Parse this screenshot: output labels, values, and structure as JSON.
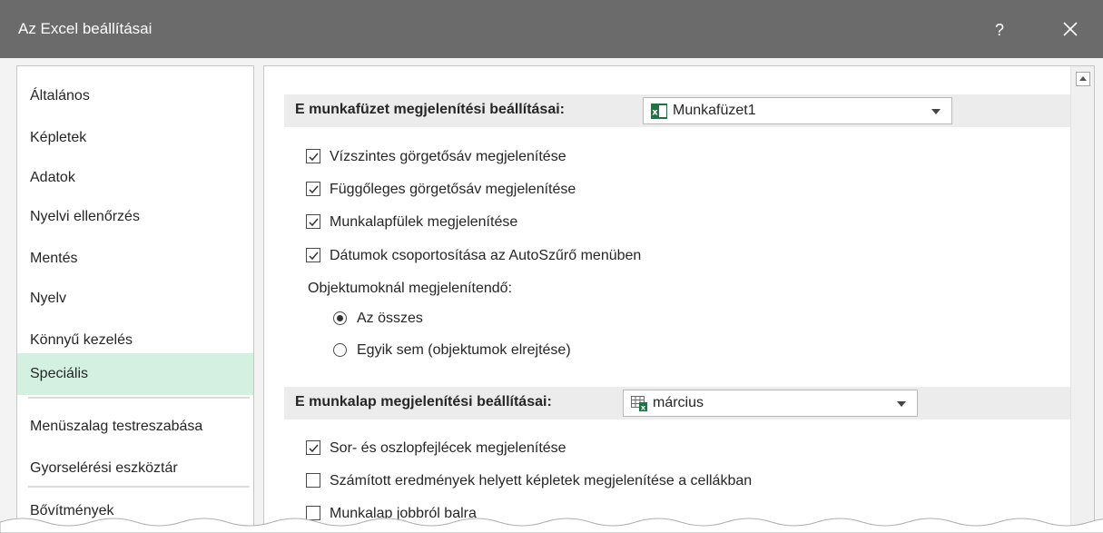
{
  "window": {
    "title": "Az Excel beállításai",
    "help_label": "?"
  },
  "sidebar": {
    "items": [
      {
        "label": "Általános"
      },
      {
        "label": "Képletek"
      },
      {
        "label": "Adatok"
      },
      {
        "label": "Nyelvi ellenőrzés"
      },
      {
        "label": "Mentés"
      },
      {
        "label": "Nyelv"
      },
      {
        "label": "Könnyű kezelés"
      },
      {
        "label": "Speciális"
      },
      {
        "label": "Menüszalag testreszabása"
      },
      {
        "label": "Gyorselérési eszköztár"
      },
      {
        "label": "Bővítmények"
      }
    ],
    "selected_index": 7
  },
  "workbook_section": {
    "label": "E munkafüzet megjelenítési beállításai:",
    "combo_value": "Munkafüzet1",
    "options": [
      {
        "label": "Vízszintes görgetősáv megjelenítése",
        "checked": true
      },
      {
        "label": "Függőleges görgetősáv megjelenítése",
        "checked": true
      },
      {
        "label": "Munkalapfülek megjelenítése",
        "checked": true
      },
      {
        "label": "Dátumok csoportosítása az AutoSzűrő menüben",
        "checked": true
      }
    ],
    "objects_label": "Objektumoknál megjelenítendő:",
    "radios": [
      {
        "label": "Az összes",
        "selected": true
      },
      {
        "label": "Egyik sem (objektumok elrejtése)",
        "selected": false
      }
    ]
  },
  "sheet_section": {
    "label": "E munkalap megjelenítési beállításai:",
    "combo_value": "március",
    "options": [
      {
        "label": "Sor- és oszlopfejlécek megjelenítése",
        "checked": true
      },
      {
        "label": "Számított eredmények helyett képletek megjelenítése a cellákban",
        "checked": false
      },
      {
        "label": "Munkalap jobbról balra",
        "checked": false
      }
    ]
  },
  "colors": {
    "titlebar": "#6b6b6b",
    "selected_nav": "#d3f0e0",
    "excel_green": "#217346"
  },
  "icons": {
    "close": "close-icon",
    "excel_workbook": "excel-workbook-icon",
    "excel_sheet": "excel-sheet-icon"
  }
}
